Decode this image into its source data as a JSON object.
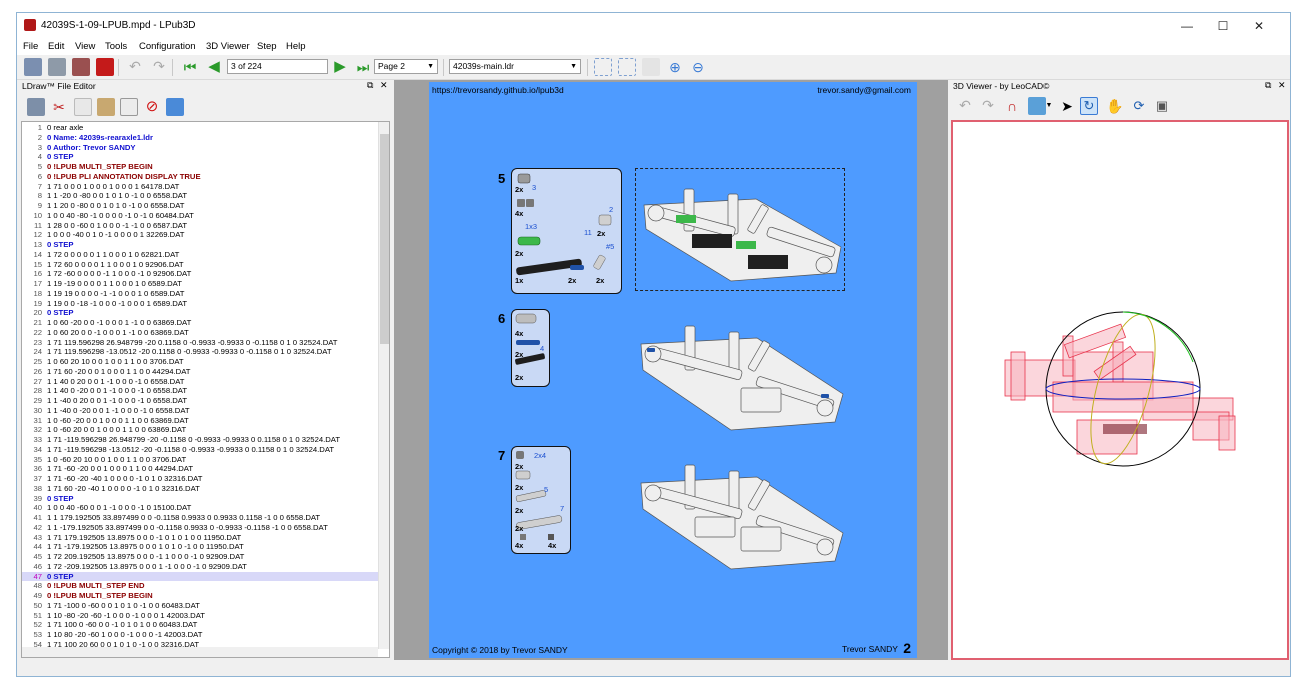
{
  "window": {
    "title": "42039S-1-09-LPUB.mpd - LPub3D"
  },
  "menu": [
    "File",
    "Edit",
    "View",
    "Tools",
    "Configuration",
    "3D Viewer",
    "Step",
    "Help"
  ],
  "toolbar": {
    "page_field": "3 of 224",
    "page_select": "Page 2",
    "model_select": "42039s-main.ldr"
  },
  "editor": {
    "title": "LDraw™ File Editor",
    "current_line": 47,
    "lines": [
      {
        "n": "1",
        "t": "0 rear axle",
        "k": ""
      },
      {
        "n": "2",
        "t": "0 Name: 42039s-rearaxle1.ldr",
        "k": "step"
      },
      {
        "n": "3",
        "t": "0 Author: Trevor SANDY",
        "k": "step"
      },
      {
        "n": "4",
        "t": "0 STEP",
        "k": "step"
      },
      {
        "n": "5",
        "t": "0 !LPUB MULTI_STEP BEGIN",
        "k": "meta"
      },
      {
        "n": "6",
        "t": "0 !LPUB PLI ANNOTATION DISPLAY TRUE",
        "k": "meta"
      },
      {
        "n": "7",
        "t": "1 71 0 0 0 1 0 0 0 1 0 0 0 1 64178.DAT",
        "k": ""
      },
      {
        "n": "8",
        "t": "1 1 -20 0 -80 0 0 1 0 1 0 -1 0 0 6558.DAT",
        "k": ""
      },
      {
        "n": "9",
        "t": "1 1 20 0 -80 0 0 1 0 1 0 -1 0 0 6558.DAT",
        "k": ""
      },
      {
        "n": "10",
        "t": "1 0 0 40 -80 -1 0 0 0 0 -1 0 -1 0 60484.DAT",
        "k": ""
      },
      {
        "n": "11",
        "t": "1 28 0 0 -60 0 1 0 0 0 -1 -1 0 0 6587.DAT",
        "k": ""
      },
      {
        "n": "12",
        "t": "1 0 0 0 -40 0 1 0 -1 0 0 0 0 1 32269.DAT",
        "k": ""
      },
      {
        "n": "13",
        "t": "0 STEP",
        "k": "step"
      },
      {
        "n": "14",
        "t": "1 72 0 0 0 0 0 1 1 0 0 0 1 0 62821.DAT",
        "k": ""
      },
      {
        "n": "15",
        "t": "1 72 60 0 0 0 0 1 1 0 0 0 1 0 92906.DAT",
        "k": ""
      },
      {
        "n": "16",
        "t": "1 72 -60 0 0 0 0 -1 1 0 0 0 -1 0 92906.DAT",
        "k": ""
      },
      {
        "n": "17",
        "t": "1 19 -19 0 0 0 0 1 1 0 0 0 1 0 6589.DAT",
        "k": ""
      },
      {
        "n": "18",
        "t": "1 19 19 0 0 0 0 -1 -1 0 0 0 1 0 6589.DAT",
        "k": ""
      },
      {
        "n": "19",
        "t": "1 19 0 0 -18 -1 0 0 0 -1 0 0 0 1 6589.DAT",
        "k": ""
      },
      {
        "n": "20",
        "t": "0 STEP",
        "k": "step"
      },
      {
        "n": "21",
        "t": "1 0 60 -20 0 0 -1 0 0 0 1 -1 0 0 63869.DAT",
        "k": ""
      },
      {
        "n": "22",
        "t": "1 0 60 20 0 0 -1 0 0 0 1 -1 0 0 63869.DAT",
        "k": ""
      },
      {
        "n": "23",
        "t": "1 71 119.596298 26.948799 -20 0.1158 0 -0.9933 -0.9933 0 -0.1158 0 1 0 32524.DAT",
        "k": ""
      },
      {
        "n": "24",
        "t": "1 71 119.596298 -13.0512 -20 0.1158 0 -0.9933 -0.9933 0 -0.1158 0 1 0 32524.DAT",
        "k": ""
      },
      {
        "n": "25",
        "t": "1 0 60 20 10 0 0 1 0 0 1 1 0 0 3706.DAT",
        "k": ""
      },
      {
        "n": "26",
        "t": "1 71 60 -20 0 0 1 0 0 0 1 1 0 0 44294.DAT",
        "k": ""
      },
      {
        "n": "27",
        "t": "1 1 40 0 20 0 0 1 -1 0 0 0 -1 0 6558.DAT",
        "k": ""
      },
      {
        "n": "28",
        "t": "1 1 40 0 -20 0 0 1 -1 0 0 0 -1 0 6558.DAT",
        "k": ""
      },
      {
        "n": "29",
        "t": "1 1 -40 0 20 0 0 1 -1 0 0 0 -1 0 6558.DAT",
        "k": ""
      },
      {
        "n": "30",
        "t": "1 1 -40 0 -20 0 0 1 -1 0 0 0 -1 0 6558.DAT",
        "k": ""
      },
      {
        "n": "31",
        "t": "1 0 -60 -20 0 0 1 0 0 0 1 1 0 0 63869.DAT",
        "k": ""
      },
      {
        "n": "32",
        "t": "1 0 -60 20 0 0 1 0 0 0 1 1 0 0 63869.DAT",
        "k": ""
      },
      {
        "n": "33",
        "t": "1 71 -119.596298 26.948799 -20 -0.1158 0 -0.9933 -0.9933 0 0.1158 0 1 0 32524.DAT",
        "k": ""
      },
      {
        "n": "34",
        "t": "1 71 -119.596298 -13.0512 -20 -0.1158 0 -0.9933 -0.9933 0 0.1158 0 1 0 32524.DAT",
        "k": ""
      },
      {
        "n": "35",
        "t": "1 0 -60 20 10 0 0 1 0 0 1 1 0 0 3706.DAT",
        "k": ""
      },
      {
        "n": "36",
        "t": "1 71 -60 -20 0 0 1 0 0 0 1 1 0 0 44294.DAT",
        "k": ""
      },
      {
        "n": "37",
        "t": "1 71 -60 -20 -40 1 0 0 0 0 -1 0 1 0 32316.DAT",
        "k": ""
      },
      {
        "n": "38",
        "t": "1 71 60 -20 -40 1 0 0 0 0 -1 0 1 0 32316.DAT",
        "k": ""
      },
      {
        "n": "39",
        "t": "0 STEP",
        "k": "step"
      },
      {
        "n": "40",
        "t": "1 0 0 40 -60 0 0 1 -1 0 0 0 -1 0 15100.DAT",
        "k": ""
      },
      {
        "n": "41",
        "t": "1 1 179.192505 33.897499 0 0 -0.1158 0.9933 0 0.9933 0.1158 -1 0 0 6558.DAT",
        "k": ""
      },
      {
        "n": "42",
        "t": "1 1 -179.192505 33.897499 0 0 -0.1158 0.9933 0 -0.9933 -0.1158 -1 0 0 6558.DAT",
        "k": ""
      },
      {
        "n": "43",
        "t": "1 71 179.192505 13.8975 0 0 0 -1 0 1 0 1 0 0 11950.DAT",
        "k": ""
      },
      {
        "n": "44",
        "t": "1 71 -179.192505 13.8975 0 0 0 1 0 1 0 -1 0 0 11950.DAT",
        "k": ""
      },
      {
        "n": "45",
        "t": "1 72 209.192505 13.8975 0 0 0 -1 1 0 0 0 -1 0 92909.DAT",
        "k": ""
      },
      {
        "n": "46",
        "t": "1 72 -209.192505 13.8975 0 0 0 1 -1 0 0 0 -1 0 92909.DAT",
        "k": ""
      },
      {
        "n": "47",
        "t": "0 STEP",
        "k": "step"
      },
      {
        "n": "48",
        "t": "0 !LPUB MULTI_STEP END",
        "k": "meta"
      },
      {
        "n": "49",
        "t": "0 !LPUB MULTI_STEP BEGIN",
        "k": "meta"
      },
      {
        "n": "50",
        "t": "1 71 -100 0 -60 0 0 1 0 1 0 -1 0 0 60483.DAT",
        "k": ""
      },
      {
        "n": "51",
        "t": "1 10 -80 -20 -60 -1 0 0 0 -1 0 0 0 1 42003.DAT",
        "k": ""
      },
      {
        "n": "52",
        "t": "1 71 100 0 -60 0 0 -1 0 1 0 1 0 0 60483.DAT",
        "k": ""
      },
      {
        "n": "53",
        "t": "1 10 80 -20 -60 1 0 0 0 -1 0 0 0 -1 42003.DAT",
        "k": ""
      },
      {
        "n": "54",
        "t": "1 71 100 20 60 0 0 1 0 1 0 -1 0 0 32316.DAT",
        "k": ""
      }
    ]
  },
  "page": {
    "url": "https://trevorsandy.github.io/lpub3d",
    "email": "trevor.sandy@gmail.com",
    "copyright": "Copyright © 2018 by Trevor SANDY",
    "author": "Trevor SANDY",
    "number": "2",
    "steps": [
      {
        "num": "5",
        "parts": [
          {
            "qty": "2x",
            "ann": "3"
          },
          {
            "qty": "4x",
            "ann": ""
          },
          {
            "qty": "2x",
            "ann": "1x3"
          },
          {
            "qty": "2x",
            "ann": "2"
          },
          {
            "qty": "1x",
            "ann": "11"
          },
          {
            "qty": "2x",
            "ann": ""
          },
          {
            "qty": "2x",
            "ann": "#5"
          }
        ]
      },
      {
        "num": "6",
        "parts": [
          {
            "qty": "4x",
            "ann": ""
          },
          {
            "qty": "2x",
            "ann": "4"
          },
          {
            "qty": "2x",
            "ann": ""
          }
        ]
      },
      {
        "num": "7",
        "parts": [
          {
            "qty": "2x",
            "ann": "2x4"
          },
          {
            "qty": "2x",
            "ann": ""
          },
          {
            "qty": "2x",
            "ann": "5"
          },
          {
            "qty": "2x",
            "ann": "7"
          },
          {
            "qty": "4x",
            "ann": ""
          },
          {
            "qty": "4x",
            "ann": ""
          }
        ]
      }
    ]
  },
  "viewer": {
    "title": "3D Viewer - by LeoCAD©"
  },
  "colors": {
    "page_bg": "#4e9bff",
    "pli_bg": "#c9d9f5",
    "model_red": "#e8344d",
    "accent_blue": "#1a4fd0"
  }
}
